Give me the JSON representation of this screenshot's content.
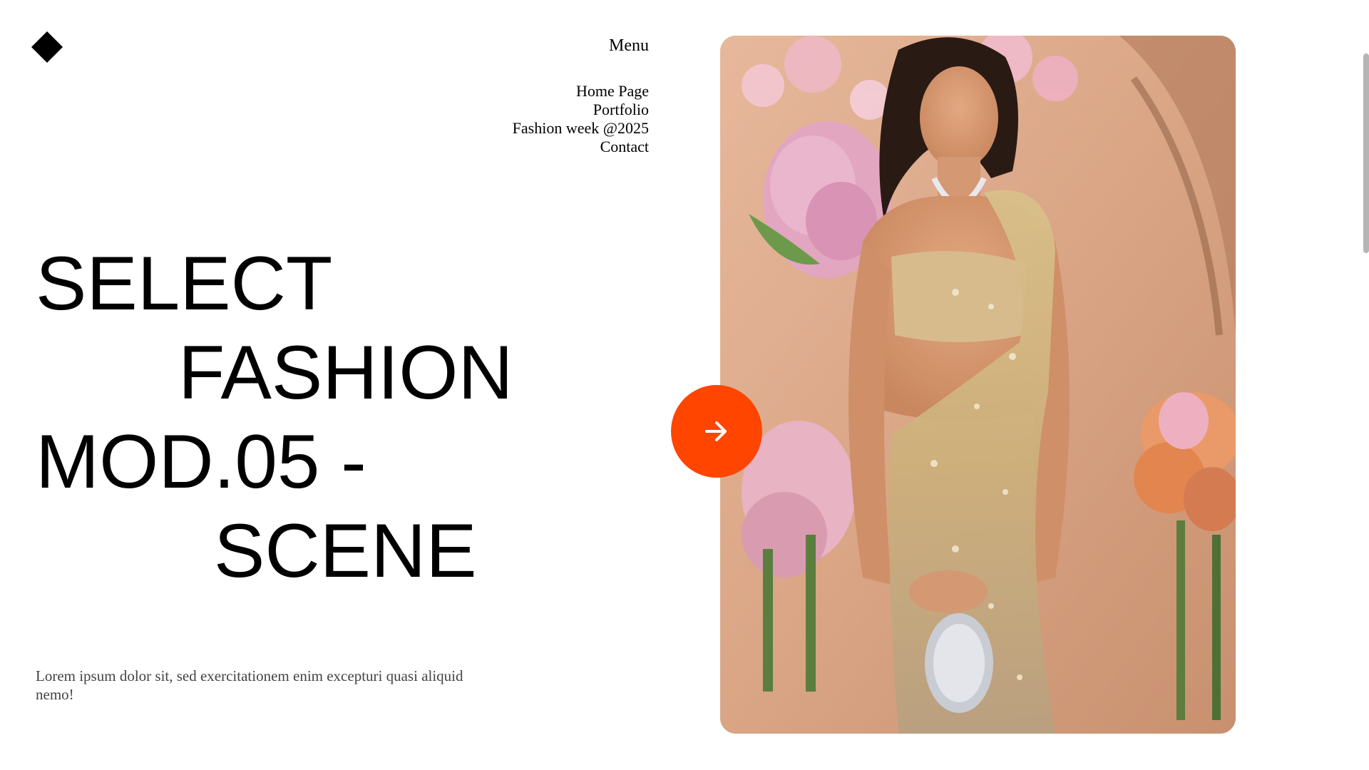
{
  "brand": {
    "logo_icon": "diamond-icon"
  },
  "nav": {
    "menu_label": "Menu",
    "items": [
      {
        "label": "Home Page"
      },
      {
        "label": "Portfolio"
      },
      {
        "label": "Fashion week @2025"
      },
      {
        "label": "Contact"
      }
    ]
  },
  "hero": {
    "lines": [
      "SELECT",
      "FASHION",
      "MOD.05 -",
      "SCENE"
    ],
    "description": "Lorem ipsum dolor sit, sed exercitationem enim excepturi quasi aliquid nemo!",
    "next_icon": "arrow-right-icon"
  },
  "colors": {
    "accent": "#ff4500",
    "text": "#000000",
    "muted_text": "#444444",
    "background": "#ffffff"
  }
}
